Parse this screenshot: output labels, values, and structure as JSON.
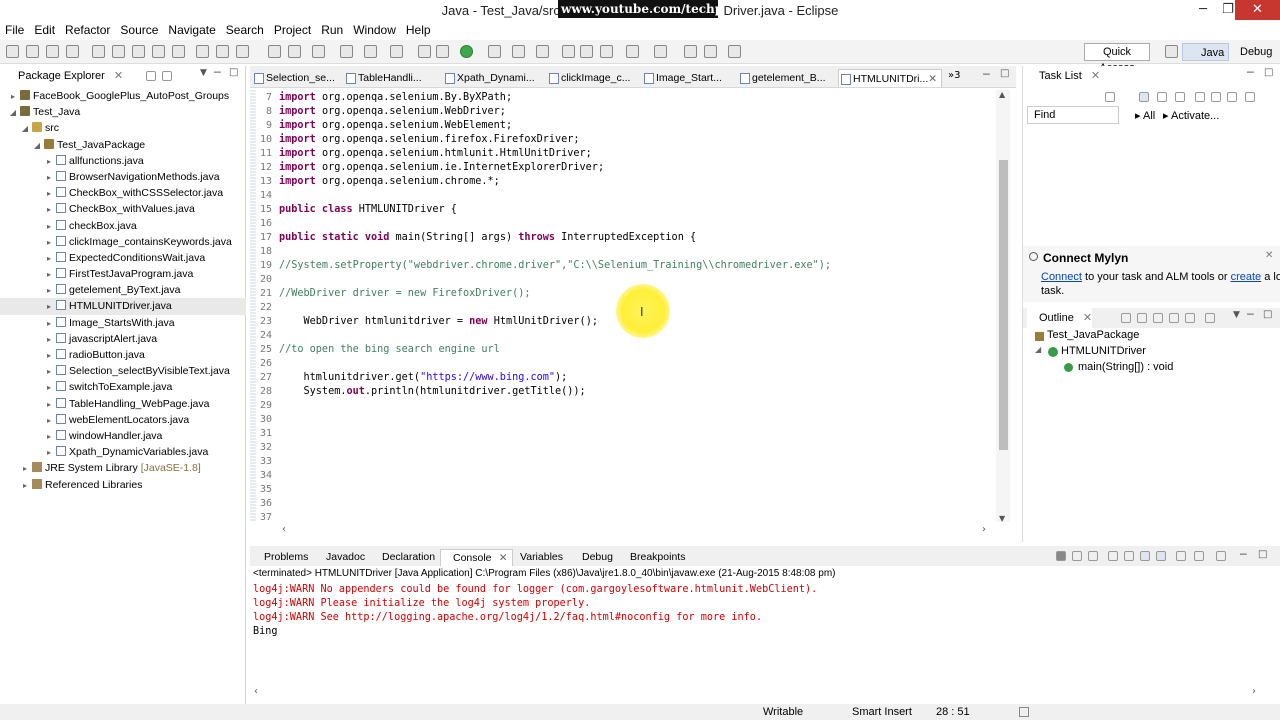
{
  "window": {
    "title_left": "Java - Test_Java/src/",
    "title_right": "Driver.java - Eclipse",
    "watermark": "www.youtube.com/techpills",
    "minimize": "─",
    "maximize": "❐",
    "close": "✕"
  },
  "menu": [
    "File",
    "Edit",
    "Refactor",
    "Source",
    "Navigate",
    "Search",
    "Project",
    "Run",
    "Window",
    "Help"
  ],
  "toolbar": {
    "quick_access": "Quick Access",
    "perspective_java": "Java",
    "perspective_debug": "Debug"
  },
  "package_explorer": {
    "title": "Package Explorer",
    "items": [
      {
        "label": "FaceBook_GooglePlus_AutoPost_Groups",
        "type": "proj"
      },
      {
        "label": "Test_Java",
        "type": "proj"
      },
      {
        "label": "src",
        "type": "src"
      },
      {
        "label": "Test_JavaPackage",
        "type": "pkg"
      },
      {
        "label": "allfunctions.java",
        "type": "java"
      },
      {
        "label": "BrowserNavigationMethods.java",
        "type": "java"
      },
      {
        "label": "CheckBox_withCSSSelector.java",
        "type": "java"
      },
      {
        "label": "CheckBox_withValues.java",
        "type": "java"
      },
      {
        "label": "checkBox.java",
        "type": "java"
      },
      {
        "label": "clickImage_containsKeywords.java",
        "type": "java"
      },
      {
        "label": "ExpectedConditionsWait.java",
        "type": "java"
      },
      {
        "label": "FirstTestJavaProgram.java",
        "type": "java"
      },
      {
        "label": "getelement_ByText.java",
        "type": "java"
      },
      {
        "label": "HTMLUNITDriver.java",
        "type": "java"
      },
      {
        "label": "Image_StartsWith.java",
        "type": "java"
      },
      {
        "label": "javascriptAlert.java",
        "type": "java"
      },
      {
        "label": "radioButton.java",
        "type": "java"
      },
      {
        "label": "Selection_selectByVisibleText.java",
        "type": "java"
      },
      {
        "label": "switchToExample.java",
        "type": "java"
      },
      {
        "label": "TableHandling_WebPage.java",
        "type": "java"
      },
      {
        "label": "webElementLocators.java",
        "type": "java"
      },
      {
        "label": "windowHandler.java",
        "type": "java"
      },
      {
        "label": "Xpath_DynamicVariables.java",
        "type": "java"
      },
      {
        "label": "JRE System Library",
        "suffix": "[JavaSE-1.8]",
        "type": "lib"
      },
      {
        "label": "Referenced Libraries",
        "type": "ref"
      }
    ]
  },
  "editor": {
    "tabs": [
      "Selection_se...",
      "TableHandli...",
      "Xpath_Dynami...",
      "clickImage_c...",
      "Image_Start...",
      "getelement_B...",
      "HTMLUNITDri..."
    ],
    "tab_overflow": "»3",
    "lines": [
      {
        "n": "7",
        "parts": [
          [
            "kw",
            "import "
          ],
          [
            "t",
            "org.openqa.selenium.By.ByXPath;"
          ]
        ]
      },
      {
        "n": "8",
        "parts": [
          [
            "kw",
            "import "
          ],
          [
            "t",
            "org.openqa.selenium.WebDriver;"
          ]
        ]
      },
      {
        "n": "9",
        "parts": [
          [
            "kw",
            "import "
          ],
          [
            "t",
            "org.openqa.selenium.WebElement;"
          ]
        ]
      },
      {
        "n": "10",
        "parts": [
          [
            "kw",
            "import "
          ],
          [
            "t",
            "org.openqa.selenium.firefox.FirefoxDriver;"
          ]
        ]
      },
      {
        "n": "11",
        "parts": [
          [
            "kw",
            "import "
          ],
          [
            "t",
            "org.openqa.selenium.htmlunit.HtmlUnitDriver;"
          ]
        ]
      },
      {
        "n": "12",
        "parts": [
          [
            "kw",
            "import "
          ],
          [
            "t",
            "org.openqa.selenium.ie.InternetExplorerDriver;"
          ]
        ]
      },
      {
        "n": "13",
        "parts": [
          [
            "kw",
            "import "
          ],
          [
            "t",
            "org.openqa.selenium.chrome.*;"
          ]
        ]
      },
      {
        "n": "14",
        "parts": []
      },
      {
        "n": "15",
        "parts": [
          [
            "kw",
            "public class "
          ],
          [
            "t",
            "HTMLUNITDriver {"
          ]
        ]
      },
      {
        "n": "16",
        "parts": []
      },
      {
        "n": "17",
        "parts": [
          [
            "kw",
            "public static void "
          ],
          [
            "t",
            "main(String[] args) "
          ],
          [
            "kw",
            "throws "
          ],
          [
            "t",
            "InterruptedException {"
          ]
        ]
      },
      {
        "n": "18",
        "parts": []
      },
      {
        "n": "19",
        "parts": [
          [
            "cm",
            "//System.setProperty(\"webdriver.chrome.driver\",\"C:\\\\Selenium_Training\\\\chromedriver.exe\");"
          ]
        ]
      },
      {
        "n": "20",
        "parts": []
      },
      {
        "n": "21",
        "parts": [
          [
            "cm",
            "//WebDriver driver = new FirefoxDriver();"
          ]
        ]
      },
      {
        "n": "22",
        "parts": []
      },
      {
        "n": "23",
        "parts": [
          [
            "t",
            "    WebDriver htmlunitdriver = "
          ],
          [
            "kw",
            "new "
          ],
          [
            "t",
            "HtmlUnitDriver();"
          ]
        ]
      },
      {
        "n": "24",
        "parts": []
      },
      {
        "n": "25",
        "parts": [
          [
            "cm",
            "//to open the bing search engine url"
          ]
        ]
      },
      {
        "n": "26",
        "parts": []
      },
      {
        "n": "27",
        "parts": [
          [
            "t",
            "    htmlunitdriver.get("
          ],
          [
            "str",
            "\"https://www.bing.com\""
          ],
          [
            "t",
            ");"
          ]
        ]
      },
      {
        "n": "28",
        "parts": [
          [
            "t",
            "    System."
          ],
          [
            "kw",
            "out"
          ],
          [
            "t",
            ".println(htmlunitdriver.getTitle());"
          ]
        ]
      },
      {
        "n": "29",
        "parts": []
      },
      {
        "n": "30",
        "parts": []
      },
      {
        "n": "31",
        "parts": []
      },
      {
        "n": "32",
        "parts": []
      },
      {
        "n": "33",
        "parts": []
      },
      {
        "n": "34",
        "parts": []
      },
      {
        "n": "35",
        "parts": []
      },
      {
        "n": "36",
        "parts": []
      },
      {
        "n": "37",
        "parts": []
      }
    ]
  },
  "right_panel": {
    "task_list_title": "Task List",
    "find_placeholder": "Find",
    "all": "All",
    "activate": "Activate...",
    "mylyn_title": "Connect Mylyn",
    "mylyn_connect": "Connect",
    "mylyn_text1": " to your task and ALM tools or ",
    "mylyn_create": "create",
    "mylyn_text2": " a local",
    "mylyn_text3": "task.",
    "outline_title": "Outline",
    "outline_items": [
      "Test_JavaPackage",
      "HTMLUNITDriver",
      "main(String[]) : void"
    ]
  },
  "console": {
    "tabs": [
      "Problems",
      "Javadoc",
      "Declaration",
      "Console",
      "Variables",
      "Debug",
      "Breakpoints"
    ],
    "terminated": "<terminated> HTMLUNITDriver [Java Application] C:\\Program Files (x86)\\Java\\jre1.8.0_40\\bin\\javaw.exe (21-Aug-2015 8:48:08 pm)",
    "lines": [
      {
        "text": "log4j:WARN No appenders could be found for logger (com.gargoylesoftware.htmlunit.WebClient).",
        "err": true
      },
      {
        "text": "log4j:WARN Please initialize the log4j system properly.",
        "err": true
      },
      {
        "text": "log4j:WARN See http://logging.apache.org/log4j/1.2/faq.html#noconfig for more info.",
        "err": true
      },
      {
        "text": "Bing",
        "err": false
      }
    ]
  },
  "status": {
    "writable": "Writable",
    "insert": "Smart Insert",
    "position": "28 : 51"
  }
}
